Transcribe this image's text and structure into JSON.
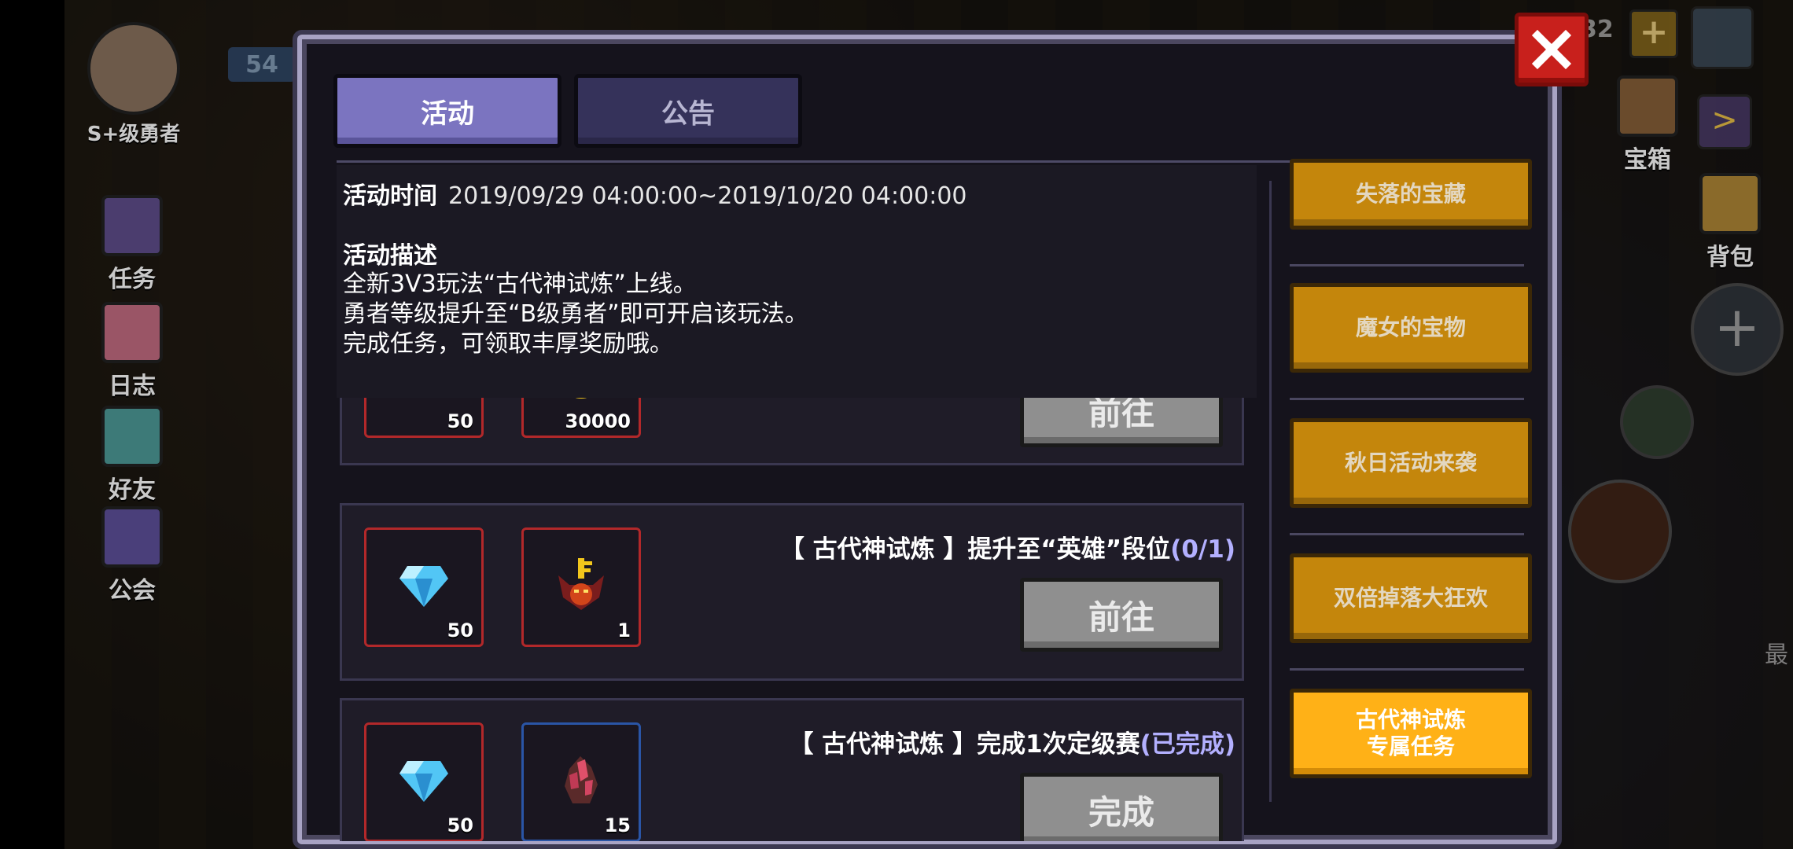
{
  "background": {
    "player_title": "S+级勇者",
    "level_badge": "54",
    "left_menu": [
      {
        "label": "任务",
        "icon": "exclamation-icon"
      },
      {
        "label": "日志",
        "icon": "pig-icon"
      },
      {
        "label": "好友",
        "icon": "ghost-icon"
      },
      {
        "label": "公会",
        "icon": "banner-icon"
      }
    ],
    "right_menu": [
      {
        "label": "宝箱",
        "icon": "chest-icon"
      },
      {
        "label": "背包",
        "icon": "backpack-icon"
      }
    ],
    "currency_fragment": "32",
    "edge_label": "最"
  },
  "dialog": {
    "tabs": [
      {
        "label": "活动",
        "active": true
      },
      {
        "label": "公告",
        "active": false
      }
    ],
    "info": {
      "time_label": "活动时间",
      "time_value": "2019/09/29 04:00:00~2019/10/20 04:00:00",
      "desc_title": "活动描述",
      "desc_lines": [
        "全新3V3玩法“古代神试炼”上线。",
        "勇者等级提升至“B级勇者”即可开启该玩法。",
        "完成任务，可领取丰厚奖励哦。"
      ]
    },
    "tasks": [
      {
        "title": "",
        "status": "",
        "button": "前往",
        "rewards": [
          {
            "icon": "diamond-icon",
            "count": "50",
            "frame": "red"
          },
          {
            "icon": "coin-icon",
            "count": "30000",
            "frame": "red"
          }
        ]
      },
      {
        "title": "【 古代神试炼 】提升至“英雄”段位",
        "status": "(0/1)",
        "button": "前往",
        "rewards": [
          {
            "icon": "diamond-icon",
            "count": "50",
            "frame": "red"
          },
          {
            "icon": "demon-key-icon",
            "count": "1",
            "frame": "red"
          }
        ]
      },
      {
        "title": "【 古代神试炼 】完成1次定级赛",
        "status": "(已完成)",
        "button": "完成",
        "rewards": [
          {
            "icon": "diamond-icon",
            "count": "50",
            "frame": "red"
          },
          {
            "icon": "crystal-ore-icon",
            "count": "15",
            "frame": "blue"
          }
        ]
      }
    ],
    "categories": [
      {
        "label": "失落的宝藏",
        "active": false
      },
      {
        "label": "魔女的宝物",
        "active": false
      },
      {
        "label": "秋日活动来袭",
        "active": false
      },
      {
        "label": "双倍掉落大狂欢",
        "active": false
      },
      {
        "label": "古代神试炼\n专属任务",
        "active": true
      }
    ]
  },
  "colors": {
    "accent_tab": "#7b74c0",
    "category": "#c4860c",
    "category_active": "#ffb117",
    "status_text": "#b3b0ff",
    "close": "#c8201c"
  }
}
